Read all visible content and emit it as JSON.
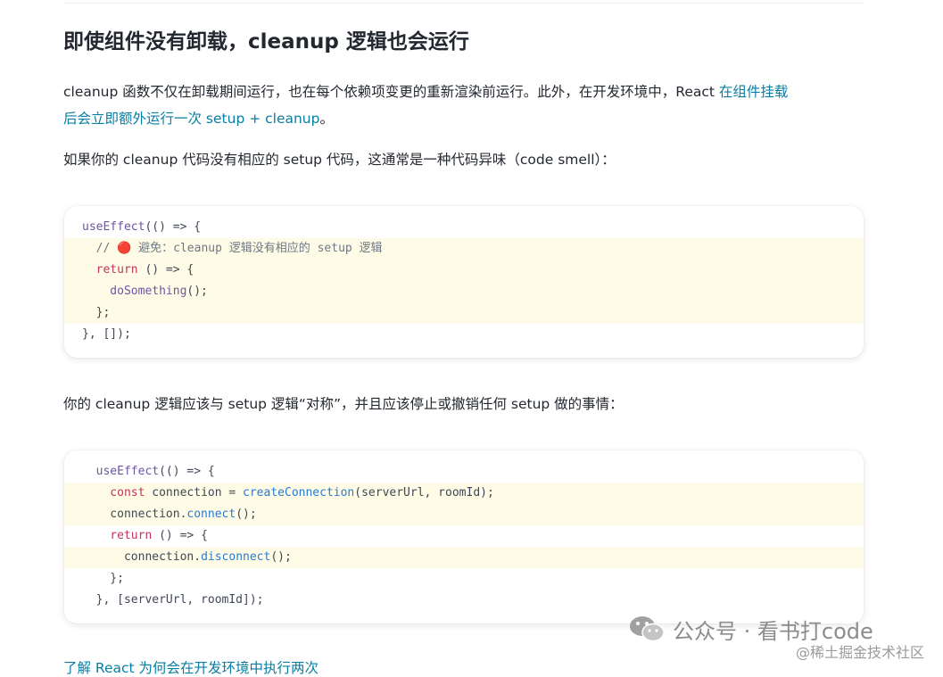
{
  "heading": "即使组件没有卸载，cleanup 逻辑也会运行",
  "para1": {
    "text": "cleanup 函数不仅在卸载期间运行，也在每个依赖项变更的重新渲染前运行。此外，在开发环境中，React ",
    "link_line1": "在组件挂载",
    "link_line2": "后会立即额外运行一次 setup + cleanup",
    "tail": "。"
  },
  "para2": "如果你的 cleanup 代码没有相应的 setup 代码，这通常是一种代码异味（code smell）：",
  "code1": [
    {
      "hl": false,
      "tokens": [
        [
          "tk-fn",
          "useEffect"
        ],
        [
          "tk-pl",
          "(() => {"
        ]
      ]
    },
    {
      "hl": true,
      "tokens": [
        [
          "tk-cm",
          "  // "
        ],
        [
          "red-dot",
          "🔴"
        ],
        [
          "tk-cm",
          " 避免：cleanup 逻辑没有相应的 setup 逻辑"
        ]
      ]
    },
    {
      "hl": true,
      "tokens": [
        [
          "tk-kw",
          "  return"
        ],
        [
          "tk-pl",
          " () => {"
        ]
      ]
    },
    {
      "hl": true,
      "tokens": [
        [
          "tk-fn",
          "    doSomething"
        ],
        [
          "tk-pl",
          "();"
        ]
      ]
    },
    {
      "hl": true,
      "tokens": [
        [
          "tk-pl",
          "  };"
        ]
      ]
    },
    {
      "hl": false,
      "tokens": [
        [
          "tk-pl",
          "}, []);"
        ]
      ]
    }
  ],
  "para3": "你的 cleanup 逻辑应该与 setup 逻辑“对称”，并且应该停止或撤销任何 setup 做的事情：",
  "code2": [
    {
      "hl": false,
      "tokens": [
        [
          "tk-fn",
          "  useEffect"
        ],
        [
          "tk-pl",
          "(() => {"
        ]
      ]
    },
    {
      "hl": true,
      "tokens": [
        [
          "tk-kw",
          "    const"
        ],
        [
          "tk-pl",
          " connection = "
        ],
        [
          "tk-cn",
          "createConnection"
        ],
        [
          "tk-pl",
          "(serverUrl, roomId);"
        ]
      ]
    },
    {
      "hl": true,
      "tokens": [
        [
          "tk-pl",
          "    connection."
        ],
        [
          "tk-cn",
          "connect"
        ],
        [
          "tk-pl",
          "();"
        ]
      ]
    },
    {
      "hl": false,
      "tokens": [
        [
          "tk-kw",
          "    return"
        ],
        [
          "tk-pl",
          " () => {"
        ]
      ]
    },
    {
      "hl": true,
      "tokens": [
        [
          "tk-pl",
          "      connection."
        ],
        [
          "tk-cn",
          "disconnect"
        ],
        [
          "tk-pl",
          "();"
        ]
      ]
    },
    {
      "hl": false,
      "tokens": [
        [
          "tk-pl",
          "    };"
        ]
      ]
    },
    {
      "hl": false,
      "tokens": [
        [
          "tk-pl",
          "  }, [serverUrl, roomId]);"
        ]
      ]
    }
  ],
  "watermark": {
    "icon": "wechat-icon",
    "text": "公众号 · 看书打code",
    "small": "@稀土掘金技术社区"
  },
  "cut_link": "了解 React 为何会在开发环境中执行两次"
}
